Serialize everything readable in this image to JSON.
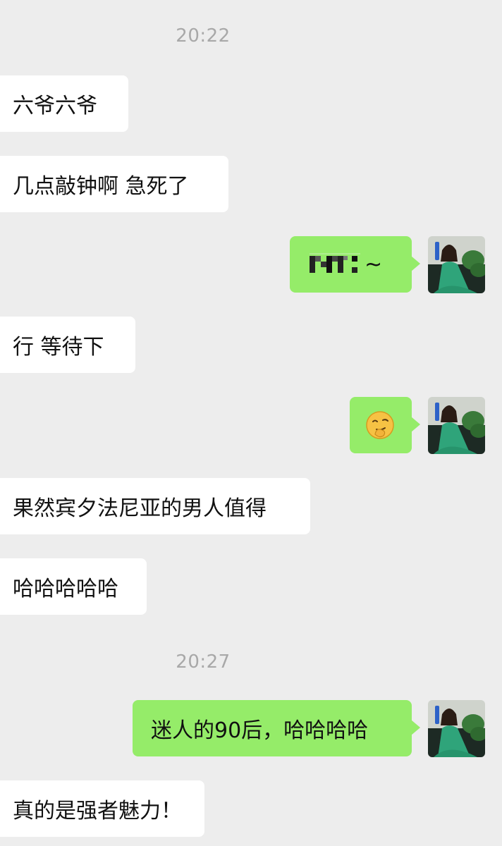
{
  "timestamps": [
    "20:22",
    "20:27"
  ],
  "messages": {
    "m1": "六爷六爷",
    "m2": "几点敲钟啊 急死了",
    "m3_suffix": "~",
    "m4": "行 等待下",
    "m5_emoji": "smirk-emoji",
    "m6": "果然宾夕法尼亚的男人值得",
    "m7": "哈哈哈哈哈",
    "m8": "迷人的90后，哈哈哈哈",
    "m9": "真的是强者魅力！"
  },
  "colors": {
    "background": "#ededed",
    "incoming_bubble": "#ffffff",
    "outgoing_bubble": "#95ec69",
    "timestamp_text": "#a8a8a8"
  },
  "icons": {
    "self_avatar": "avatar-woman-green-dress"
  }
}
